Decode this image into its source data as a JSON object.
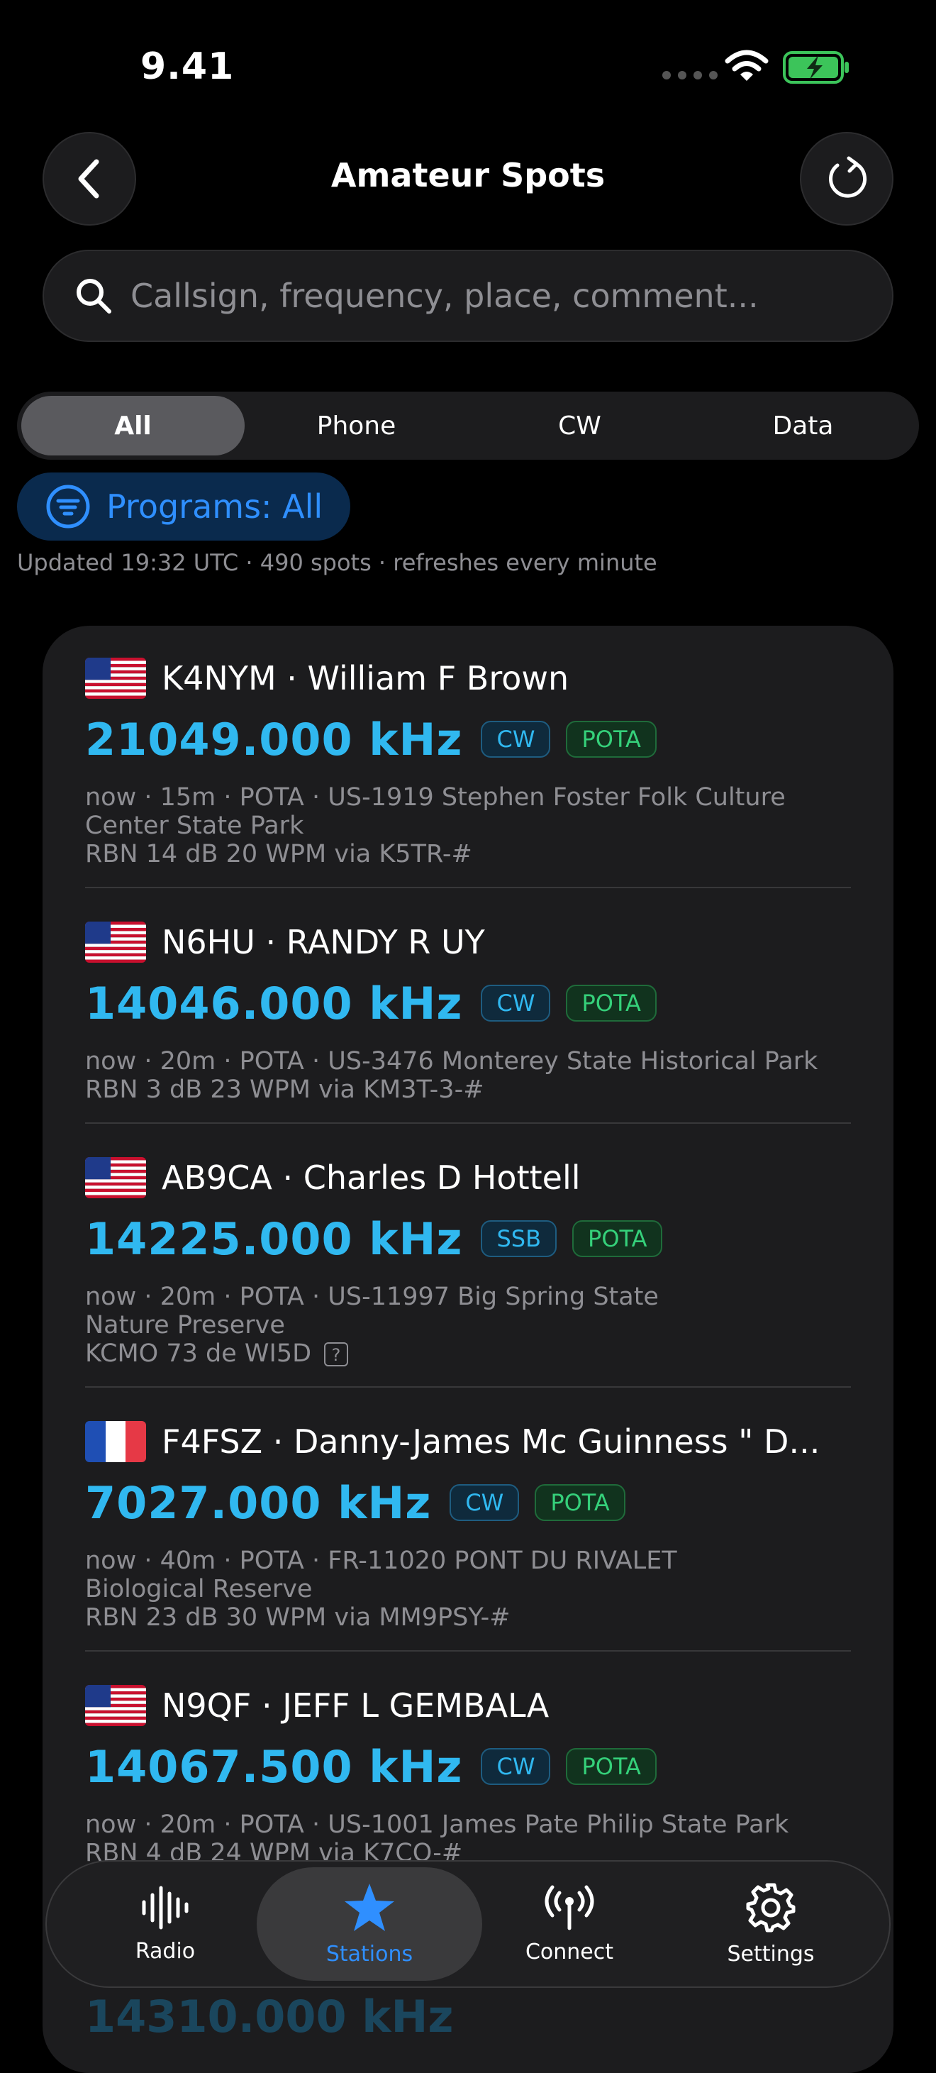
{
  "status_bar": {
    "time": "9.41"
  },
  "header": {
    "title": "Amateur Spots"
  },
  "search": {
    "placeholder": "Callsign, frequency, place, comment..."
  },
  "mode_filter": {
    "options": [
      "All",
      "Phone",
      "CW",
      "Data"
    ],
    "selected": "All"
  },
  "programs_filter": {
    "label": "Programs: All"
  },
  "update_info": "Updated 19:32 UTC · 490 spots · refreshes every minute",
  "spots": [
    {
      "flag": "us-flag",
      "title": "K4NYM · William F Brown",
      "frequency": "21049.000 kHz",
      "mode": "CW",
      "program": "POTA",
      "desc_lines": [
        "now · 15m · POTA · US-1919 Stephen Foster Folk Culture",
        "Center State Park",
        "RBN 14 dB 20 WPM via K5TR-#"
      ]
    },
    {
      "flag": "us-flag",
      "title": "N6HU · RANDY R UY",
      "frequency": "14046.000 kHz",
      "mode": "CW",
      "program": "POTA",
      "desc_lines": [
        "now · 20m · POTA · US-3476 Monterey State Historical Park",
        "RBN 3 dB 23 WPM via KM3T-3-#"
      ]
    },
    {
      "flag": "us-flag",
      "title": "AB9CA · Charles D Hottell",
      "frequency": "14225.000 kHz",
      "mode": "SSB",
      "program": "POTA",
      "desc_lines": [
        "now · 20m · POTA · US-11997 Big Spring State",
        "Nature Preserve",
        "KCMO 73 de WI5D"
      ]
    },
    {
      "flag": "fr-flag",
      "title": "F4FSZ · Danny-James Mc Guinness \" D...",
      "frequency": "7027.000 kHz",
      "mode": "CW",
      "program": "POTA",
      "desc_lines": [
        "now · 40m · POTA · FR-11020 PONT DU RIVALET",
        "Biological Reserve",
        "RBN 23 dB 30 WPM via MM9PSY-#"
      ]
    },
    {
      "flag": "us-flag",
      "title": "N9QF · JEFF L GEMBALA",
      "frequency": "14067.500 kHz",
      "mode": "CW",
      "program": "POTA",
      "desc_lines": [
        "now · 20m · POTA · US-1001 James Pate Philip State Park",
        "RBN 4 dB 24 WPM via K7CO-#"
      ]
    }
  ],
  "peek_frequency": "14310.000 kHz",
  "tabbar": {
    "tabs": [
      {
        "label": "Radio",
        "icon": "waveform-icon"
      },
      {
        "label": "Stations",
        "icon": "star-icon"
      },
      {
        "label": "Connect",
        "icon": "antenna-icon"
      },
      {
        "label": "Settings",
        "icon": "gear-icon"
      }
    ],
    "selected": "Stations"
  },
  "colors": {
    "accent": "#2f8fff",
    "frequency": "#30b8f0",
    "program_badge": "#35d07a",
    "background": "#000000",
    "card": "#1c1c1e"
  }
}
